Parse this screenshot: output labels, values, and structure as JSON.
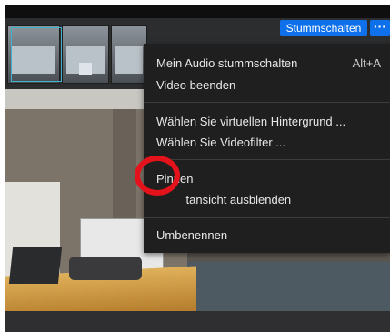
{
  "toolbar": {
    "mute_label": "Stummschalten",
    "more_label": "···"
  },
  "menu": {
    "items": [
      {
        "label": "Mein Audio stummschalten",
        "shortcut": "Alt+A"
      },
      {
        "label": "Video beenden"
      },
      {
        "label": "Wählen Sie virtuellen Hintergrund ..."
      },
      {
        "label": "Wählen Sie Videofilter ..."
      },
      {
        "label": "Pinnen"
      },
      {
        "label": "Selbstansicht ausblenden"
      },
      {
        "label": "Umbenennen"
      }
    ]
  },
  "colors": {
    "accent": "#0e71eb",
    "menu_bg": "#1f1f1f",
    "highlight": "#e4121b"
  }
}
